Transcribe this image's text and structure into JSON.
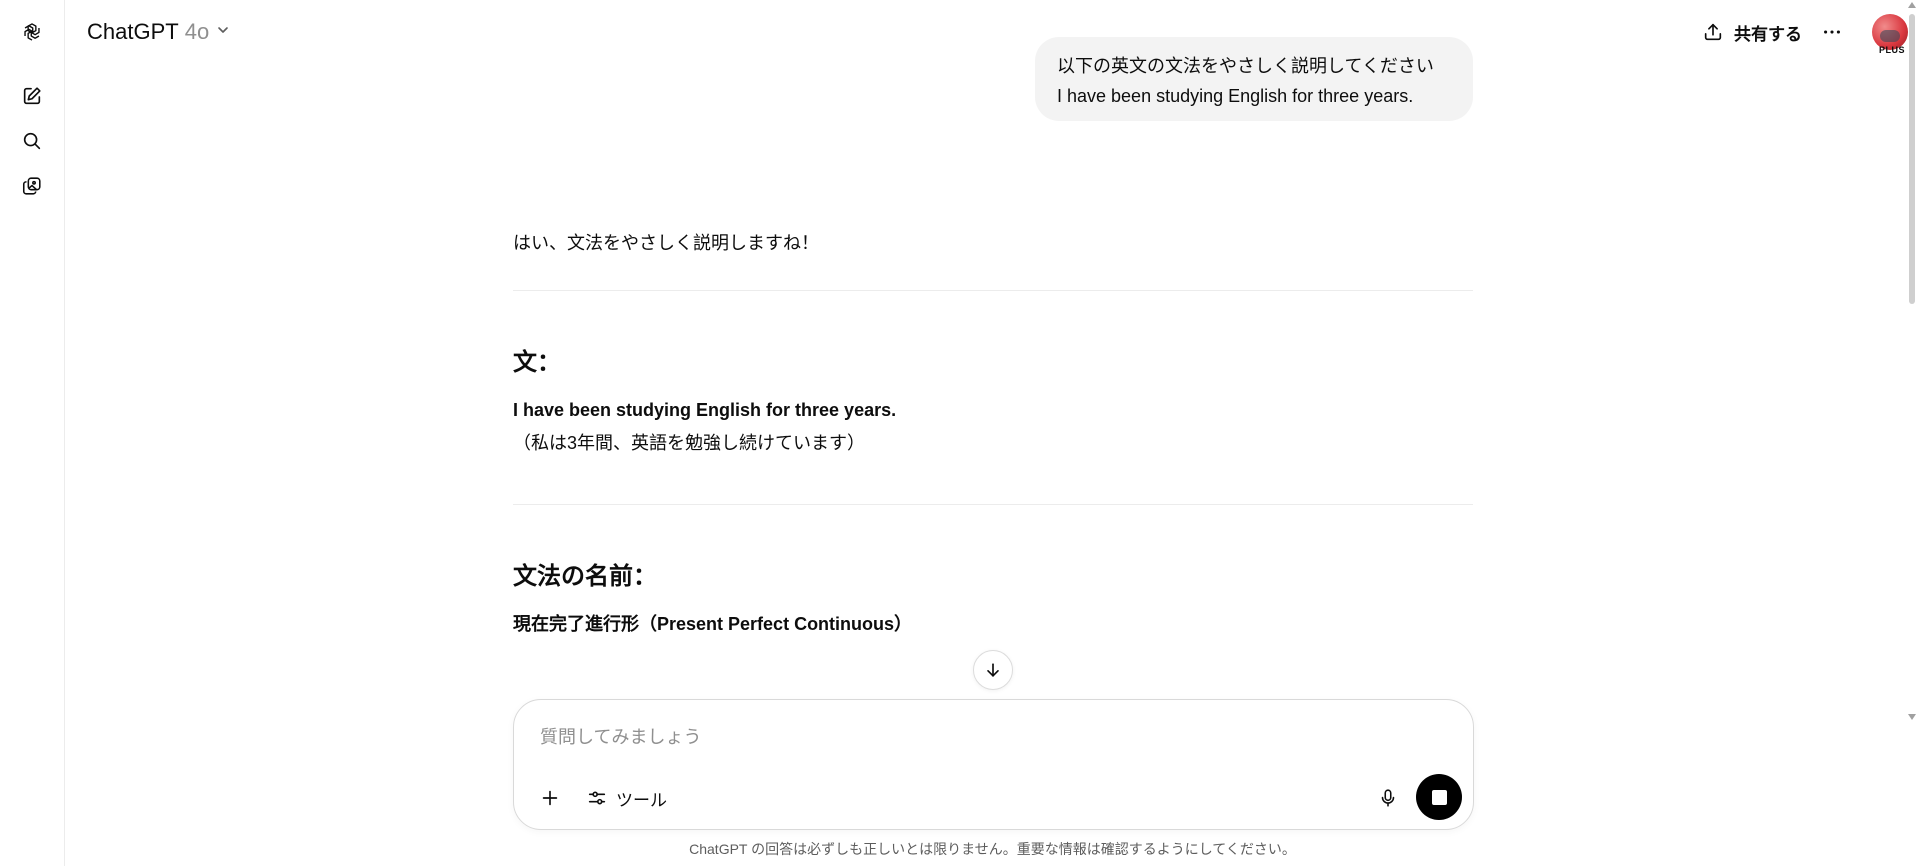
{
  "header": {
    "model_name": "ChatGPT",
    "model_version": "4o",
    "share_label": "共有する",
    "plan_badge": "PLUS"
  },
  "rail": {
    "icons": [
      "openai-logo-icon",
      "new-chat-icon",
      "search-icon",
      "image-library-icon"
    ]
  },
  "conversation": {
    "user_message": {
      "line1": "以下の英文の文法をやさしく説明してください",
      "line2": "I have been studying English for three years."
    },
    "assistant": {
      "intro": "はい、文法をやさしく説明しますね！",
      "section1": {
        "heading": "文：",
        "sentence": "I have been studying English for three years.",
        "translation": "（私は3年間、英語を勉強し続けています）"
      },
      "section2": {
        "heading": "文法の名前：",
        "name": "現在完了進行形（Present Perfect Continuous）"
      }
    }
  },
  "composer": {
    "placeholder": "質問してみましょう",
    "tools_label": "ツール"
  },
  "footer": {
    "disclaimer": "ChatGPT の回答は必ずしも正しいとは限りません。重要な情報は確認するようにしてください。"
  }
}
